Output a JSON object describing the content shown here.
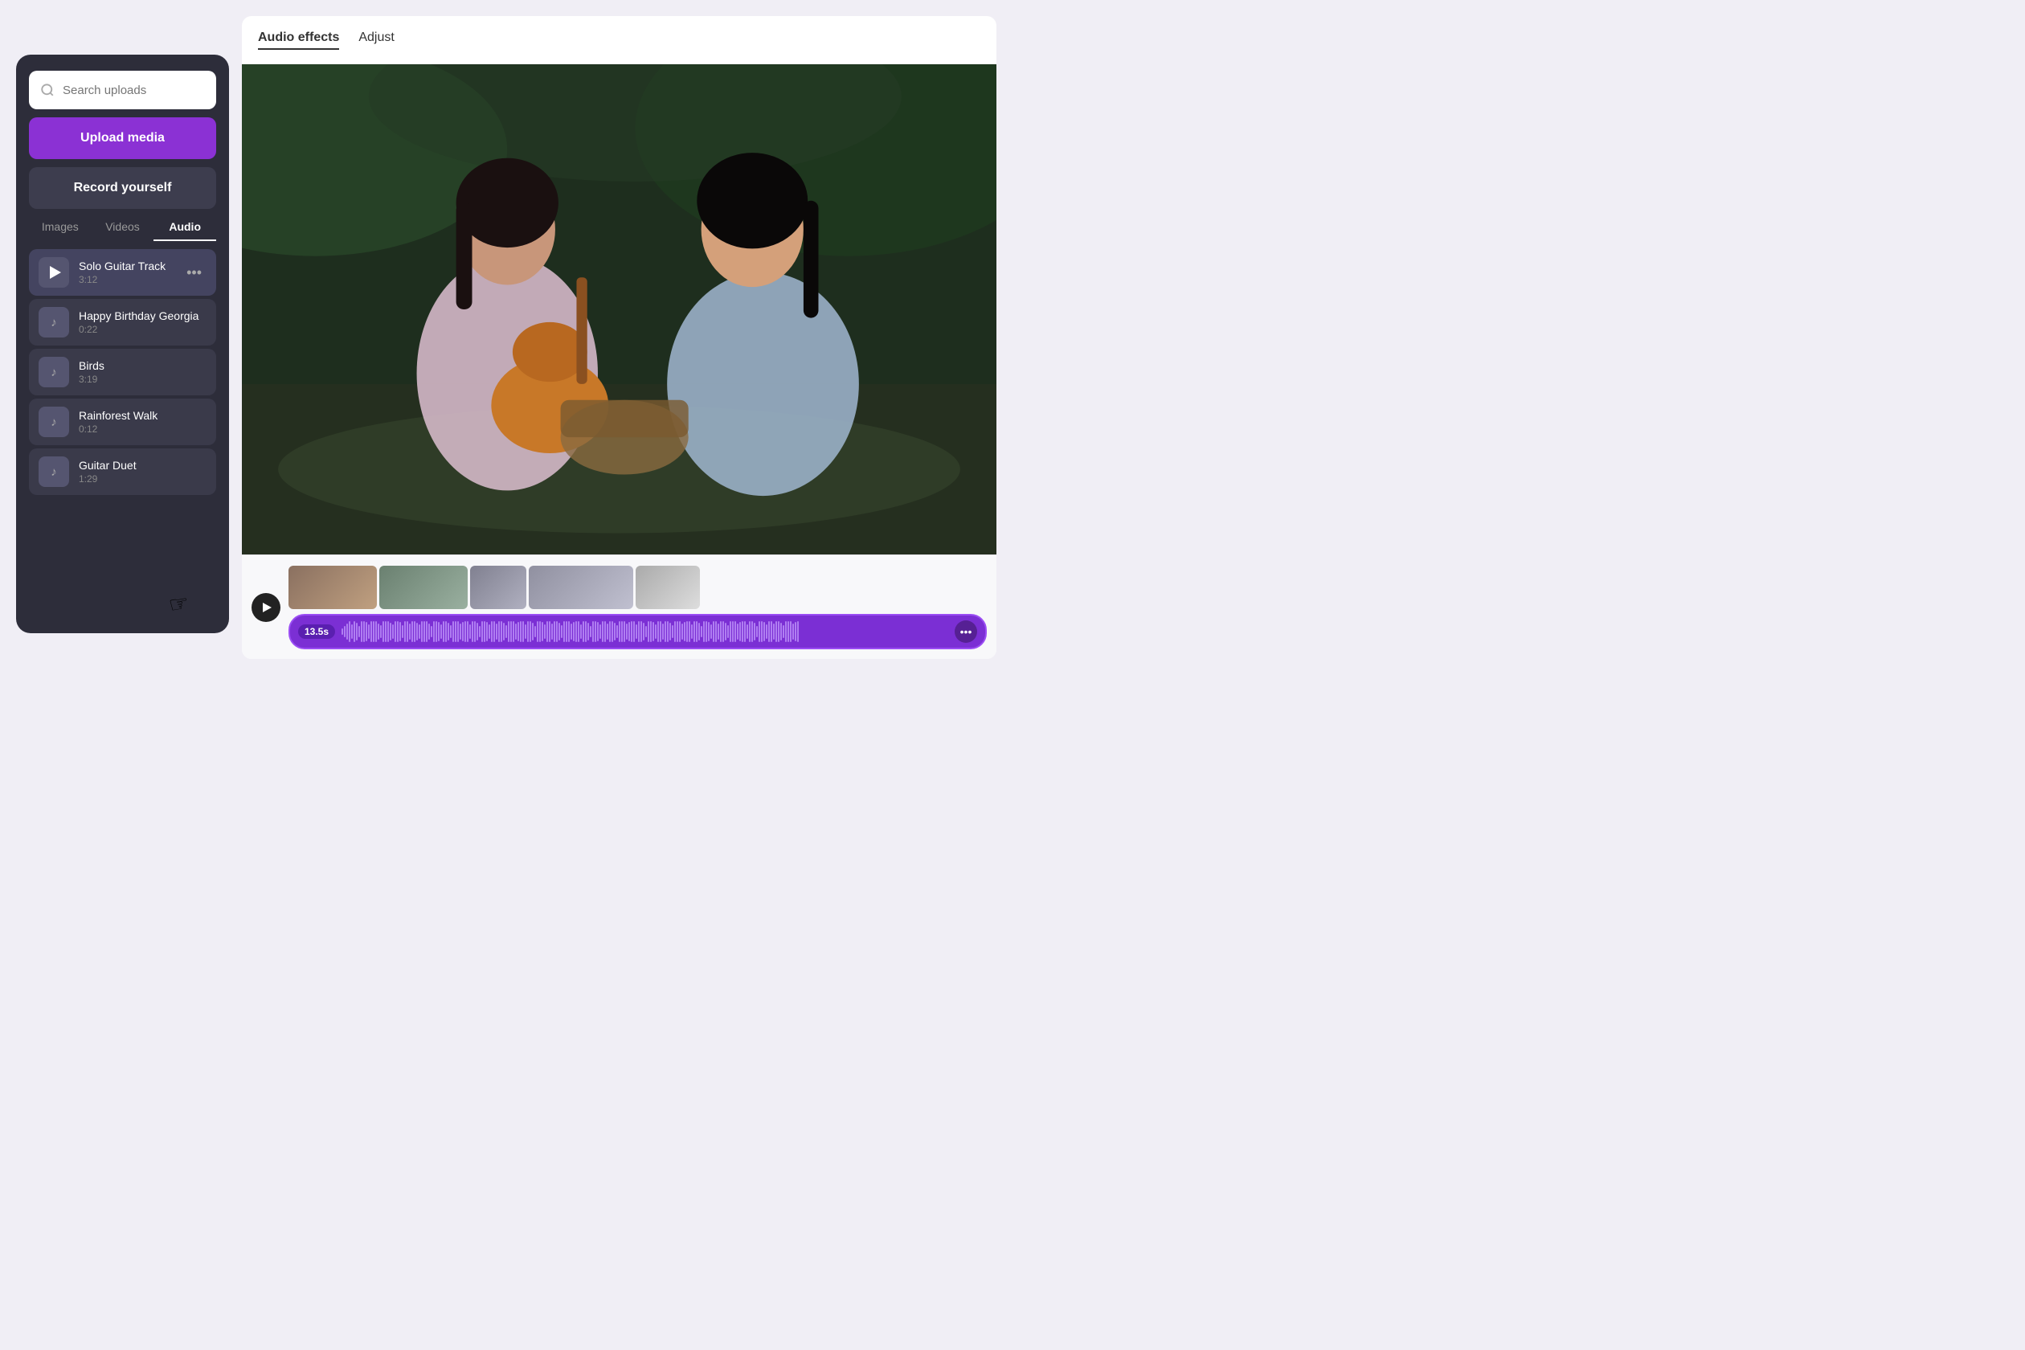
{
  "leftPanel": {
    "search": {
      "placeholder": "Search uploads"
    },
    "uploadBtn": "Upload media",
    "recordBtn": "Record yourself",
    "tabs": [
      {
        "label": "Images",
        "active": false
      },
      {
        "label": "Videos",
        "active": false
      },
      {
        "label": "Audio",
        "active": true
      }
    ],
    "audioItems": [
      {
        "name": "Solo Guitar Track",
        "duration": "3:12",
        "active": true,
        "hasPlay": true
      },
      {
        "name": "Happy Birthday Georgia",
        "duration": "0:22",
        "active": false,
        "hasPlay": false
      },
      {
        "name": "Birds",
        "duration": "3:19",
        "active": false,
        "hasPlay": false
      },
      {
        "name": "Rainforest Walk",
        "duration": "0:12",
        "active": false,
        "hasPlay": false
      },
      {
        "name": "Guitar Duet",
        "duration": "1:29",
        "active": false,
        "hasPlay": false
      }
    ]
  },
  "rightPanel": {
    "tabs": [
      {
        "label": "Audio effects",
        "active": true
      },
      {
        "label": "Adjust",
        "active": false
      }
    ],
    "timeline": {
      "playBtn": "play",
      "audioTrack": {
        "badge": "13.5s",
        "moreLabel": "•••"
      }
    }
  }
}
